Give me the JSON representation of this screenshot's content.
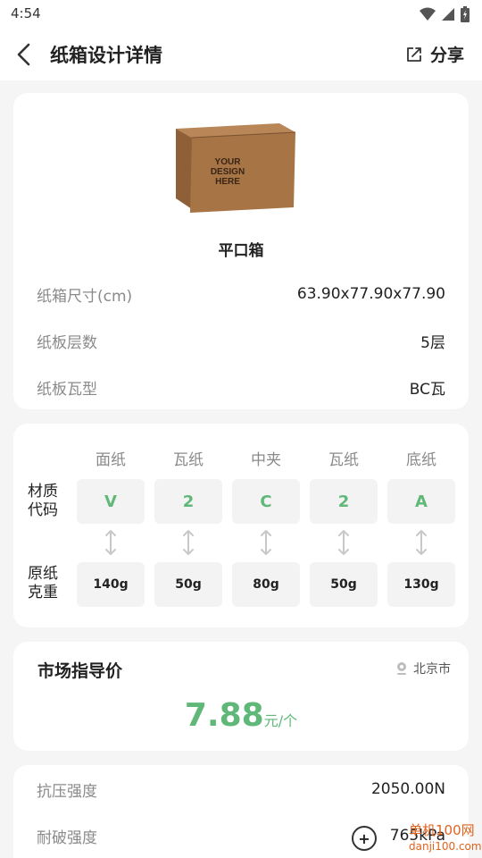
{
  "status_bar": {
    "time": "4:54"
  },
  "header": {
    "title": "纸箱设计详情",
    "share_label": "分享"
  },
  "box": {
    "image_text": [
      "YOUR",
      "DESIGN",
      "HERE"
    ],
    "name": "平口箱",
    "rows": [
      {
        "label": "纸箱尺寸(cm)",
        "value": "63.90x77.90x77.90"
      },
      {
        "label": "纸板层数",
        "value": "5层"
      },
      {
        "label": "纸板瓦型",
        "value": "BC瓦"
      }
    ]
  },
  "materials": {
    "columns": [
      "面纸",
      "瓦纸",
      "中夹",
      "瓦纸",
      "底纸"
    ],
    "code_label": [
      "材质",
      "代码"
    ],
    "weight_label": [
      "原纸",
      "克重"
    ],
    "codes": [
      "V",
      "2",
      "C",
      "2",
      "A"
    ],
    "weights": [
      "140g",
      "50g",
      "80g",
      "50g",
      "130g"
    ]
  },
  "market": {
    "title": "市场指导价",
    "location": "北京市",
    "price": "7.88",
    "unit": "元/个"
  },
  "strength": {
    "rows": [
      {
        "label": "抗压强度",
        "value": "2050.00N"
      },
      {
        "label": "耐破强度",
        "value": "765kPa"
      }
    ]
  },
  "watermark": {
    "line1": "单机100网",
    "line2": "danji100.com"
  },
  "colors": {
    "accent_green": "#5fb878",
    "background": "#f5f5f5",
    "card": "#ffffff"
  }
}
